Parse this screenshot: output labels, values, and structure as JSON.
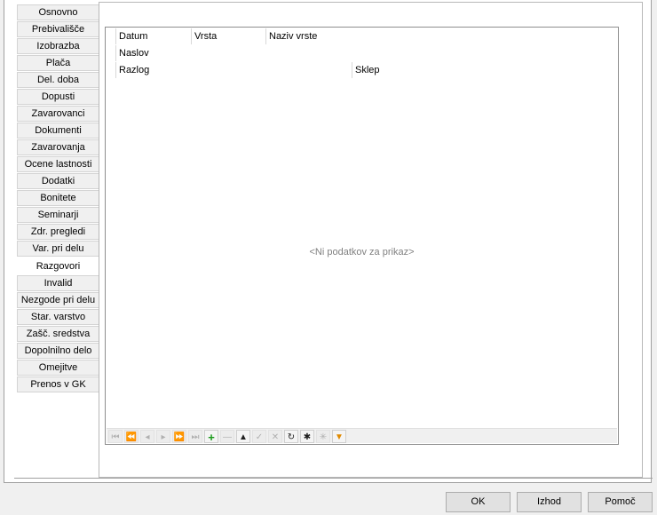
{
  "tabs": [
    {
      "label": "Osnovno",
      "active": false
    },
    {
      "label": "Prebivališče",
      "active": false
    },
    {
      "label": "Izobrazba",
      "active": false
    },
    {
      "label": "Plača",
      "active": false
    },
    {
      "label": "Del. doba",
      "active": false
    },
    {
      "label": "Dopusti",
      "active": false
    },
    {
      "label": "Zavarovanci",
      "active": false
    },
    {
      "label": "Dokumenti",
      "active": false
    },
    {
      "label": "Zavarovanja",
      "active": false
    },
    {
      "label": "Ocene lastnosti",
      "active": false
    },
    {
      "label": "Dodatki",
      "active": false
    },
    {
      "label": "Bonitete",
      "active": false
    },
    {
      "label": "Seminarji",
      "active": false
    },
    {
      "label": "Zdr. pregledi",
      "active": false
    },
    {
      "label": "Var. pri delu",
      "active": false
    },
    {
      "label": "Razgovori",
      "active": true
    },
    {
      "label": "Invalid",
      "active": false
    },
    {
      "label": "Nezgode pri delu",
      "active": false
    },
    {
      "label": "Star. varstvo",
      "active": false
    },
    {
      "label": "Zašč. sredstva",
      "active": false
    },
    {
      "label": "Dopolnilno delo",
      "active": false
    },
    {
      "label": "Omejitve",
      "active": false
    },
    {
      "label": "Prenos v GK",
      "active": false
    }
  ],
  "grid": {
    "columns": {
      "datum": "Datum",
      "vrsta": "Vrsta",
      "naziv_vrste": "Naziv vrste",
      "naslov": "Naslov",
      "razlog": "Razlog",
      "sklep": "Sklep"
    },
    "empty_text": "<Ni podatkov za prikaz>"
  },
  "navigator": [
    {
      "name": "first-record-icon",
      "glyph": "⏮",
      "enabled": false
    },
    {
      "name": "prev-page-icon",
      "glyph": "⏪",
      "enabled": false
    },
    {
      "name": "prev-record-icon",
      "glyph": "◂",
      "enabled": false
    },
    {
      "name": "next-record-icon",
      "glyph": "▸",
      "enabled": false
    },
    {
      "name": "next-page-icon",
      "glyph": "⏩",
      "enabled": false
    },
    {
      "name": "last-record-icon",
      "glyph": "⏭",
      "enabled": false
    },
    {
      "name": "insert-icon",
      "glyph": "+",
      "enabled": true
    },
    {
      "name": "delete-icon",
      "glyph": "—",
      "enabled": false
    },
    {
      "name": "edit-icon",
      "glyph": "▲",
      "enabled": true
    },
    {
      "name": "post-icon",
      "glyph": "✓",
      "enabled": false
    },
    {
      "name": "cancel-icon",
      "glyph": "✕",
      "enabled": false
    },
    {
      "name": "refresh-icon",
      "glyph": "↻",
      "enabled": true
    },
    {
      "name": "bookmark-icon",
      "glyph": "✱",
      "enabled": true
    },
    {
      "name": "goto-bookmark-icon",
      "glyph": "✳",
      "enabled": false
    },
    {
      "name": "filter-icon",
      "glyph": "▼",
      "enabled": true
    }
  ],
  "buttons": {
    "ok": "OK",
    "exit": "Izhod",
    "help": "Pomoč"
  }
}
